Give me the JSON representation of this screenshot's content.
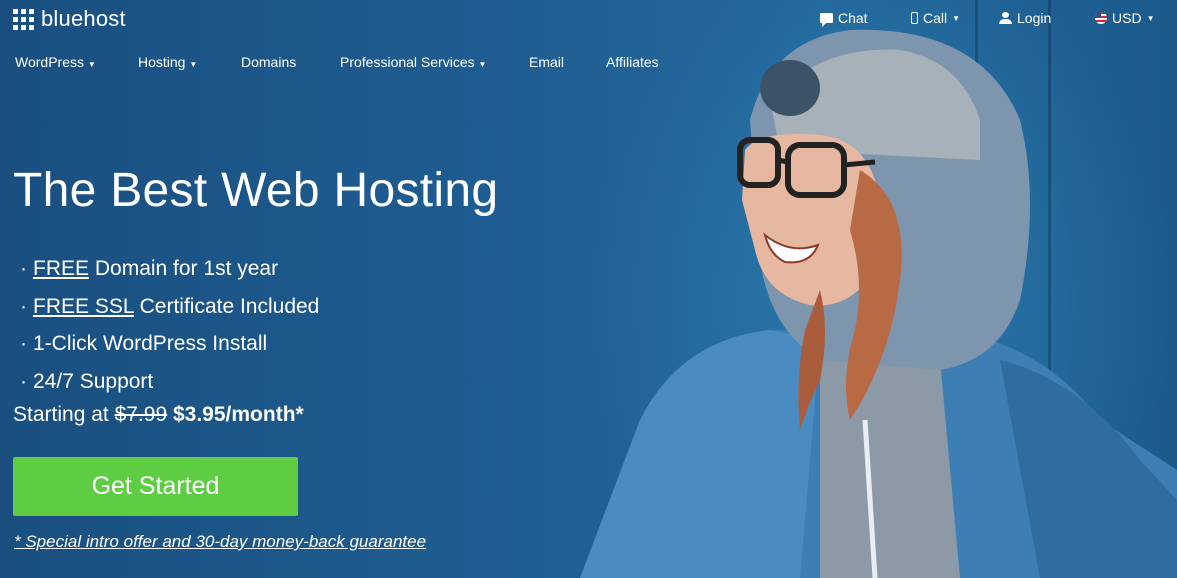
{
  "brand": {
    "name": "bluehost"
  },
  "utility_nav": {
    "chat": "Chat",
    "call": "Call",
    "login": "Login",
    "currency": "USD"
  },
  "main_nav": [
    {
      "label": "WordPress",
      "dropdown": true
    },
    {
      "label": "Hosting",
      "dropdown": true
    },
    {
      "label": "Domains",
      "dropdown": false
    },
    {
      "label": "Professional Services",
      "dropdown": true
    },
    {
      "label": "Email",
      "dropdown": false
    },
    {
      "label": "Affiliates",
      "dropdown": false
    }
  ],
  "hero": {
    "title": "The Best Web Hosting",
    "features": [
      {
        "underlined": "FREE",
        "rest": " Domain for 1st year"
      },
      {
        "underlined": "FREE SSL",
        "rest": " Certificate Included"
      },
      {
        "underlined": "",
        "rest": "1-Click WordPress Install"
      },
      {
        "underlined": "",
        "rest": "24/7 Support"
      }
    ],
    "pricing": {
      "prefix": "Starting at",
      "old_price": "$7.99",
      "new_price": "$3.95/month*"
    },
    "cta_label": "Get Started",
    "disclaimer": "* Special intro offer and 30-day money-back guarantee"
  },
  "colors": {
    "background": "#1d5f92",
    "cta_green": "#5fcd43",
    "text": "#ffffff"
  },
  "icons": [
    "grid-logo-icon",
    "chat-icon",
    "phone-icon",
    "user-icon",
    "us-flag-icon",
    "caret-down-icon"
  ]
}
